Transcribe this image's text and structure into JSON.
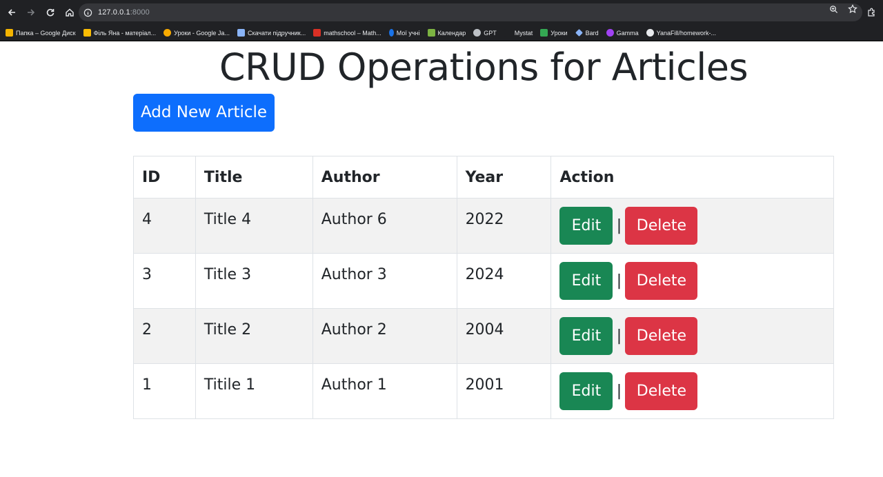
{
  "browser": {
    "url_host": "127.0.0.1",
    "url_port": ":8000",
    "bookmarks": [
      {
        "label": "Папка – Google Диск",
        "color": "#f4b400"
      },
      {
        "label": "Філь Яна - матеріал...",
        "color": "#fbbc04"
      },
      {
        "label": "Уроки - Google Ja...",
        "color": "#f9ab00"
      },
      {
        "label": "Скачати підручник...",
        "color": "#8ab4f8"
      },
      {
        "label": "mathschool – Math...",
        "color": "#d93025"
      },
      {
        "label": "Мої учні",
        "color": "#1a73e8"
      },
      {
        "label": "Календар",
        "color": "#7cb342"
      },
      {
        "label": "GPT",
        "color": "#bdc1c6"
      },
      {
        "label": "Mystat",
        "color": "#202124"
      },
      {
        "label": "Уроки",
        "color": "#34a853"
      },
      {
        "label": "Bard",
        "color": "#8ab4f8"
      },
      {
        "label": "Gamma",
        "color": "#a142f4"
      },
      {
        "label": "YanaFill/homework-...",
        "color": "#e8eaed"
      }
    ]
  },
  "page": {
    "title": "CRUD Operations for Articles",
    "add_button": "Add New Article"
  },
  "table": {
    "headers": {
      "id": "ID",
      "title": "Title",
      "author": "Author",
      "year": "Year",
      "action": "Action"
    },
    "rows": [
      {
        "id": "4",
        "title": "Title 4",
        "author": "Author 6",
        "year": "2022"
      },
      {
        "id": "3",
        "title": "Title 3",
        "author": "Author 3",
        "year": "2024"
      },
      {
        "id": "2",
        "title": "Title 2",
        "author": "Author 2",
        "year": "2004"
      },
      {
        "id": "1",
        "title": "Titile 1",
        "author": "Author 1",
        "year": "2001"
      }
    ],
    "edit_label": "Edit",
    "delete_label": "Delete",
    "separator": "|"
  },
  "colors": {
    "primary": "#0d6efd",
    "success": "#198754",
    "danger": "#dc3545"
  }
}
